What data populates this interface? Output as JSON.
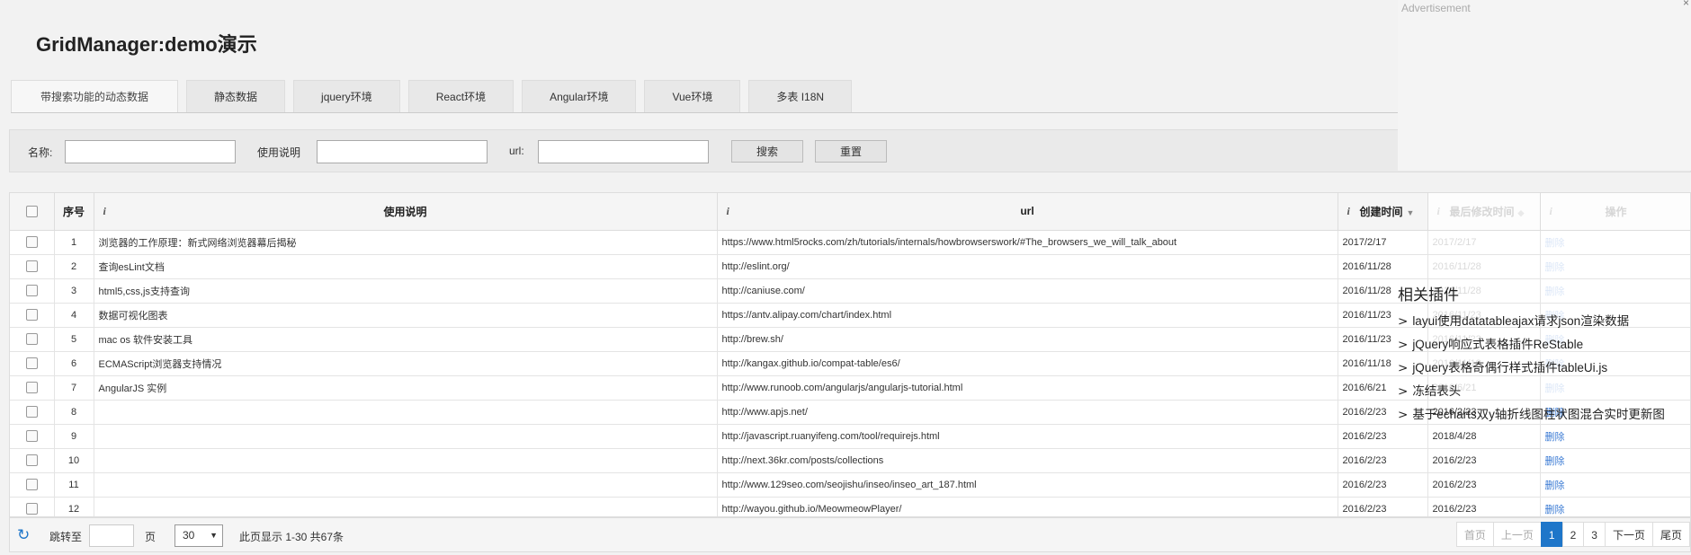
{
  "title": "GridManager:demo演示",
  "tabs": [
    "带搜索功能的动态数据",
    "静态数据",
    "jquery环境",
    "React环境",
    "Angular环境",
    "Vue环境",
    "多表 I18N"
  ],
  "search": {
    "name_label": "名称:",
    "desc_label": "使用说明",
    "url_label": "url:",
    "search_button": "搜索",
    "reset_button": "重置"
  },
  "grid": {
    "headers": {
      "index": "序号",
      "desc": "使用说明",
      "url": "url",
      "created": "创建时间",
      "modified": "最后修改时间",
      "action": "操作"
    },
    "rows": [
      {
        "no": "1",
        "desc": "浏览器的工作原理：新式网络浏览器幕后揭秘",
        "url": "https://www.html5rocks.com/zh/tutorials/internals/howbrowserswork/#The_browsers_we_will_talk_about",
        "created": "2017/2/17",
        "modified": "2017/2/17",
        "action": "删除"
      },
      {
        "no": "2",
        "desc": "查询esLint文档",
        "url": "http://eslint.org/",
        "created": "2016/11/28",
        "modified": "2016/11/28",
        "action": "删除"
      },
      {
        "no": "3",
        "desc": "html5,css,js支持查询",
        "url": "http://caniuse.com/",
        "created": "2016/11/28",
        "modified": "2016/11/28",
        "action": "删除"
      },
      {
        "no": "4",
        "desc": "数据可视化图表",
        "url": "https://antv.alipay.com/chart/index.html",
        "created": "2016/11/23",
        "modified": "2016/11/23",
        "action": "删除"
      },
      {
        "no": "5",
        "desc": "mac os 软件安装工具",
        "url": "http://brew.sh/",
        "created": "2016/11/23",
        "modified": "2016/11/23",
        "action": "删除"
      },
      {
        "no": "6",
        "desc": "ECMAScript浏览器支持情况",
        "url": "http://kangax.github.io/compat-table/es6/",
        "created": "2016/11/18",
        "modified": "2016/11/18",
        "action": "删除"
      },
      {
        "no": "7",
        "desc": "AngularJS 实例",
        "url": "http://www.runoob.com/angularjs/angularjs-tutorial.html",
        "created": "2016/6/21",
        "modified": "2016/6/21",
        "action": "删除"
      },
      {
        "no": "8",
        "desc": "",
        "url": "http://www.apjs.net/",
        "created": "2016/2/23",
        "modified": "2016/2/23",
        "action": "删除"
      },
      {
        "no": "9",
        "desc": "",
        "url": "http://javascript.ruanyifeng.com/tool/requirejs.html",
        "created": "2016/2/23",
        "modified": "2018/4/28",
        "action": "删除"
      },
      {
        "no": "10",
        "desc": "",
        "url": "http://next.36kr.com/posts/collections",
        "created": "2016/2/23",
        "modified": "2016/2/23",
        "action": "删除"
      },
      {
        "no": "11",
        "desc": "",
        "url": "http://www.129seo.com/seojishu/inseo/inseo_art_187.html",
        "created": "2016/2/23",
        "modified": "2016/2/23",
        "action": "删除"
      },
      {
        "no": "12",
        "desc": "",
        "url": "http://wayou.github.io/MeowmeowPlayer/",
        "created": "2016/2/23",
        "modified": "2016/2/23",
        "action": "删除"
      }
    ]
  },
  "footer": {
    "goto_label": "跳转至",
    "page_label": "页",
    "page_size": "30",
    "summary": "此页显示 1-30 共67条",
    "pager": [
      "首页",
      "上一页",
      "1",
      "2",
      "3",
      "下一页",
      "尾页"
    ]
  },
  "ad": {
    "label": "Advertisement",
    "close": "×"
  },
  "plugins": {
    "title": "相关插件",
    "items": [
      "layui使用datatableajax请求json渲染数据",
      "jQuery响应式表格插件ReStable",
      "jQuery表格奇偶行样式插件tableUi.js",
      "冻结表头",
      "基于echarts双y轴折线图柱状图混合实时更新图"
    ]
  },
  "colors": {
    "accent": "#1e76c9",
    "link": "#3b7bd4"
  }
}
